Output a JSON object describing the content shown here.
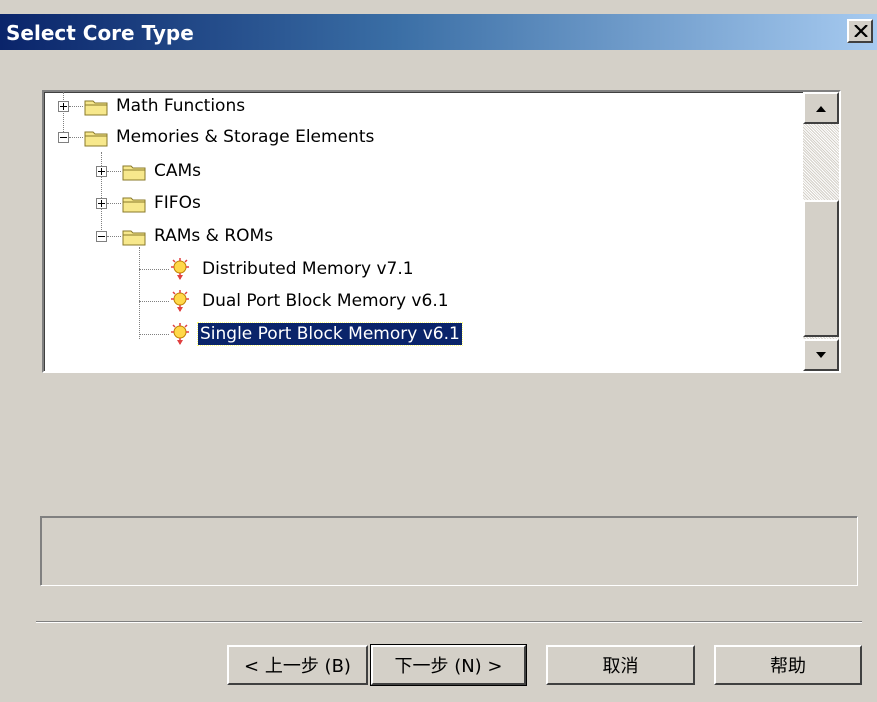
{
  "window": {
    "title": "Select Core Type"
  },
  "tree": {
    "items": [
      {
        "label": "Math Functions",
        "type": "folder",
        "expanded": false,
        "level": 0
      },
      {
        "label": "Memories & Storage Elements",
        "type": "folder",
        "expanded": true,
        "level": 0
      },
      {
        "label": "CAMs",
        "type": "folder",
        "expanded": false,
        "level": 1
      },
      {
        "label": "FIFOs",
        "type": "folder",
        "expanded": false,
        "level": 1
      },
      {
        "label": "RAMs & ROMs",
        "type": "folder",
        "expanded": true,
        "level": 1
      },
      {
        "label": "Distributed Memory v7.1",
        "type": "core",
        "level": 2
      },
      {
        "label": "Dual Port Block Memory v6.1",
        "type": "core",
        "level": 2
      },
      {
        "label": "Single Port Block Memory v6.1",
        "type": "core",
        "level": 2,
        "selected": true
      }
    ]
  },
  "buttons": {
    "back": "< 上一步 (B)",
    "next": "下一步 (N) >",
    "cancel": "取消",
    "help": "帮助"
  },
  "colors": {
    "titlebar_start": "#0a246a",
    "titlebar_end": "#a6caf0",
    "selection": "#0a246a",
    "face": "#d4d0c8"
  },
  "icons": {
    "close": "close-icon",
    "folder": "folder-icon",
    "core": "core-ip-icon",
    "expand": "plus-icon",
    "collapse": "minus-icon"
  }
}
